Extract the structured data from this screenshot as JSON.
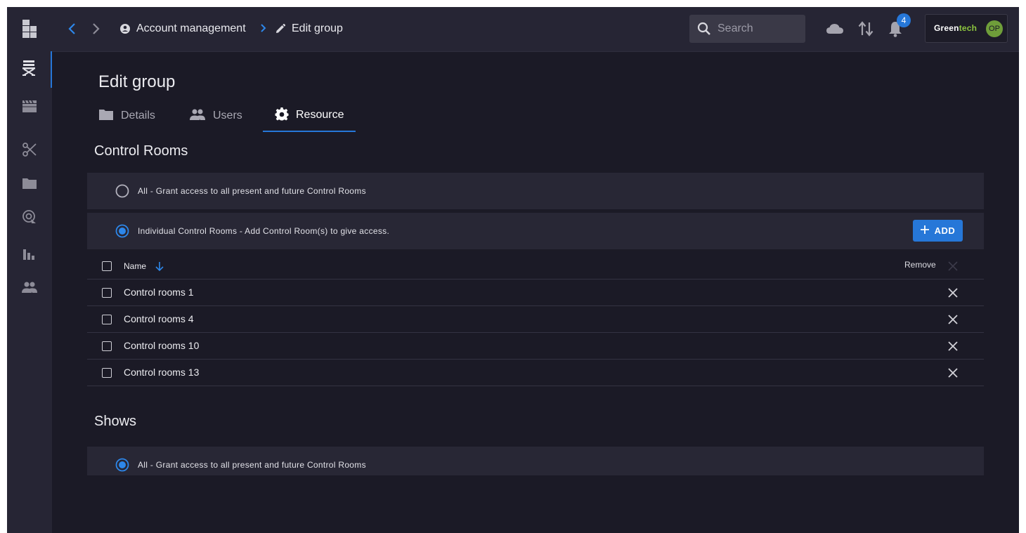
{
  "topbar": {
    "breadcrumbs": [
      "Account management",
      "Edit group"
    ],
    "search_placeholder": "Search",
    "notification_count": "4",
    "org_name_prefix": "Green",
    "org_name_suffix": "tech",
    "avatar_initials": "OP"
  },
  "sidebar": {
    "items": [
      "director-chair-icon",
      "clapperboard-icon",
      "scissors-icon",
      "folder-icon",
      "media-icon",
      "bar-chart-icon",
      "people-icon"
    ],
    "active_index": 0
  },
  "page": {
    "title": "Edit group",
    "tabs": [
      {
        "label": "Details",
        "icon": "folder-icon"
      },
      {
        "label": "Users",
        "icon": "people-icon"
      },
      {
        "label": "Resource",
        "icon": "gear-icon"
      }
    ],
    "active_tab": "Resource"
  },
  "control_rooms": {
    "title": "Control Rooms",
    "option_all": "All - Grant access to all present and future Control Rooms",
    "option_individual": "Individual Control Rooms - Add Control Room(s) to give access.",
    "selected": "individual",
    "add_label": "ADD",
    "table": {
      "col_name": "Name",
      "col_remove": "Remove",
      "rows": [
        "Control rooms 1",
        "Control rooms 4",
        "Control rooms 10",
        "Control rooms 13"
      ]
    }
  },
  "shows": {
    "title": "Shows",
    "option_all": "All - Grant access to all present and future Control Rooms",
    "selected": "all"
  },
  "colors": {
    "accent": "#2677d8",
    "background": "#1b1a26",
    "panel": "#282735",
    "bar": "#262534"
  }
}
